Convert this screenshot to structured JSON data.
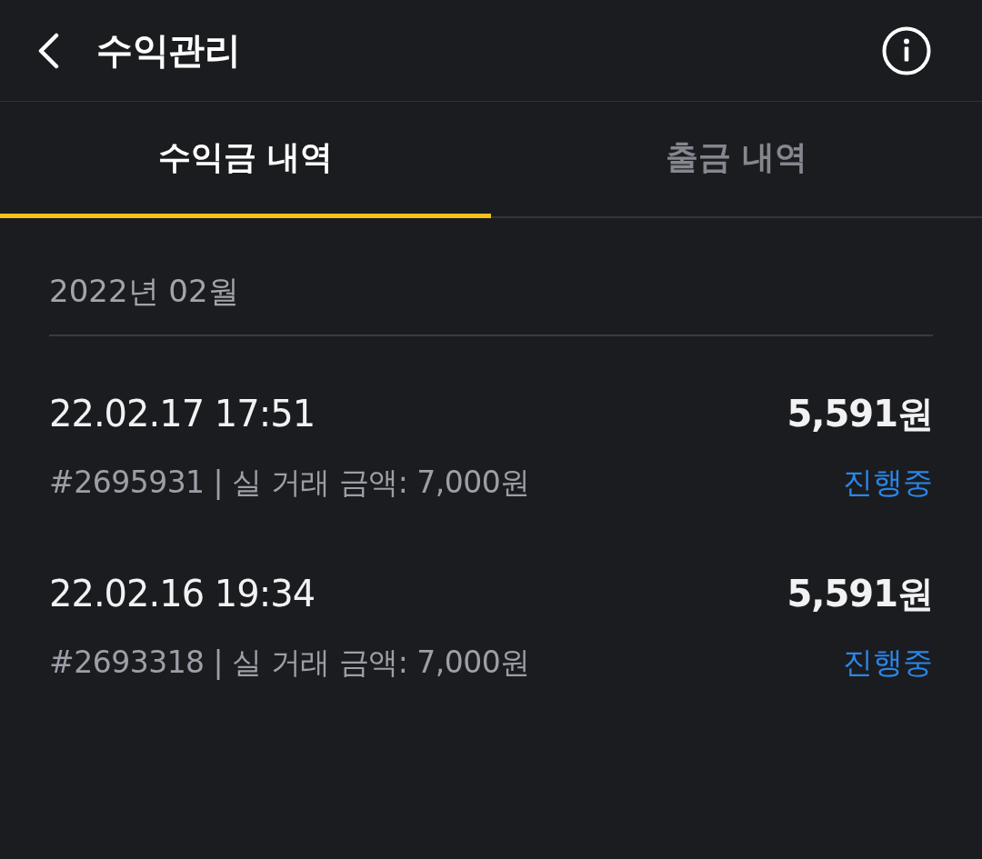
{
  "header": {
    "title": "수익관리"
  },
  "tabs": [
    {
      "label": "수익금 내역",
      "selected": true
    },
    {
      "label": "출금 내역",
      "selected": false
    }
  ],
  "month": {
    "label": "2022년 02월"
  },
  "entries": [
    {
      "datetime": "22.02.17 17:51",
      "amount": "5,591원",
      "detail": "#2695931 | 실 거래 금액: 7,000원",
      "status": {
        "label": "진행중",
        "kind": "in_progress"
      }
    },
    {
      "datetime": "22.02.16 19:34",
      "amount": "5,591원",
      "detail": "#2693318 | 실 거래 금액: 7,000원",
      "status": {
        "label": "진행중",
        "kind": "in_progress"
      }
    }
  ]
}
